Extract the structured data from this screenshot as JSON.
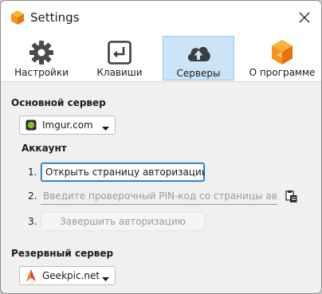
{
  "window": {
    "title": "Settings"
  },
  "tabs": [
    {
      "label": "Настройки",
      "icon": "gear-icon",
      "active": false
    },
    {
      "label": "Клавиши",
      "icon": "enter-key-icon",
      "active": false
    },
    {
      "label": "Серверы",
      "icon": "cloud-upload-icon",
      "active": true
    },
    {
      "label": "О программе",
      "icon": "app-logo-icon",
      "active": false
    }
  ],
  "primary_server": {
    "title": "Основной сервер",
    "selected": "Imgur.com",
    "icon": "imgur-icon"
  },
  "account": {
    "title": "Аккаунт",
    "step1_num": "1.",
    "step1_button": "Открыть страницу авторизации...",
    "step2_num": "2.",
    "pin_placeholder": "Введите проверочный PIN-код со страницы ав...",
    "step3_num": "3.",
    "step3_button": "Завершить авторизацию"
  },
  "backup_server": {
    "title": "Резервный сервер",
    "selected": "Geekpic.net",
    "icon": "geekpic-icon"
  },
  "colors": {
    "accent": "#0067c0",
    "active_tab_bg": "#cce4f7",
    "logo_orange": "#f7941d"
  }
}
